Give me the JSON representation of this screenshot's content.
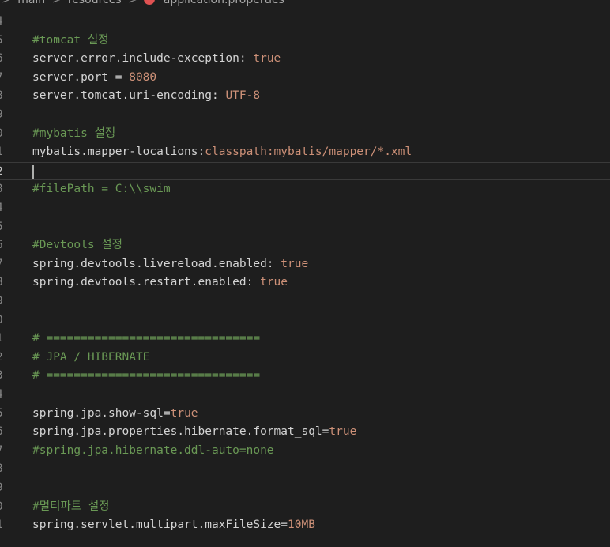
{
  "breadcrumb": {
    "items": [
      "main",
      "resources",
      "application.properties"
    ],
    "separator": ">"
  },
  "colors": {
    "key": "#d4d4d4",
    "value": "#ce9178",
    "comment": "#6a9955",
    "line_number": "#858585",
    "background": "#1e1e1e"
  },
  "editor": {
    "current_line_number": "2",
    "lines": [
      {
        "num": "4",
        "tokens": []
      },
      {
        "num": "5",
        "tokens": [
          {
            "type": "com",
            "text": "#tomcat 설정"
          }
        ]
      },
      {
        "num": "6",
        "tokens": [
          {
            "type": "key",
            "text": "server.error.include-exception: "
          },
          {
            "type": "val",
            "text": "true"
          }
        ]
      },
      {
        "num": "7",
        "tokens": [
          {
            "type": "key",
            "text": "server.port = "
          },
          {
            "type": "val",
            "text": "8080"
          }
        ]
      },
      {
        "num": "8",
        "tokens": [
          {
            "type": "key",
            "text": "server.tomcat.uri-encoding: "
          },
          {
            "type": "val",
            "text": "UTF-8"
          }
        ]
      },
      {
        "num": "9",
        "tokens": []
      },
      {
        "num": "0",
        "tokens": [
          {
            "type": "com",
            "text": "#mybatis 설정"
          }
        ]
      },
      {
        "num": "1",
        "tokens": [
          {
            "type": "key",
            "text": "mybatis.mapper-locations:"
          },
          {
            "type": "val",
            "text": "classpath:mybatis/mapper/*.xml"
          }
        ]
      },
      {
        "num": "2",
        "tokens": [],
        "current": true
      },
      {
        "num": "3",
        "tokens": [
          {
            "type": "com",
            "text": "#filePath = C:\\\\swim"
          }
        ]
      },
      {
        "num": "4",
        "tokens": []
      },
      {
        "num": "5",
        "tokens": []
      },
      {
        "num": "6",
        "tokens": [
          {
            "type": "com",
            "text": "#Devtools 설정"
          }
        ]
      },
      {
        "num": "7",
        "tokens": [
          {
            "type": "key",
            "text": "spring.devtools.livereload.enabled: "
          },
          {
            "type": "val",
            "text": "true"
          }
        ]
      },
      {
        "num": "8",
        "tokens": [
          {
            "type": "key",
            "text": "spring.devtools.restart.enabled: "
          },
          {
            "type": "val",
            "text": "true"
          }
        ]
      },
      {
        "num": "9",
        "tokens": []
      },
      {
        "num": "0",
        "tokens": []
      },
      {
        "num": "1",
        "tokens": [
          {
            "type": "com",
            "text": "# ==============================="
          }
        ]
      },
      {
        "num": "2",
        "tokens": [
          {
            "type": "com",
            "text": "# JPA / HIBERNATE"
          }
        ]
      },
      {
        "num": "3",
        "tokens": [
          {
            "type": "com",
            "text": "# ==============================="
          }
        ]
      },
      {
        "num": "4",
        "tokens": []
      },
      {
        "num": "5",
        "tokens": [
          {
            "type": "key",
            "text": "spring.jpa.show-sql="
          },
          {
            "type": "val",
            "text": "true"
          }
        ]
      },
      {
        "num": "6",
        "tokens": [
          {
            "type": "key",
            "text": "spring.jpa.properties.hibernate.format_sql="
          },
          {
            "type": "val",
            "text": "true"
          }
        ]
      },
      {
        "num": "7",
        "tokens": [
          {
            "type": "com",
            "text": "#spring.jpa.hibernate.ddl-auto=none"
          }
        ]
      },
      {
        "num": "8",
        "tokens": []
      },
      {
        "num": "9",
        "tokens": []
      },
      {
        "num": "0",
        "tokens": [
          {
            "type": "com",
            "text": "#멀티파트 설정"
          }
        ]
      },
      {
        "num": "1",
        "tokens": [
          {
            "type": "key",
            "text": "spring.servlet.multipart.maxFileSize="
          },
          {
            "type": "val",
            "text": "10MB"
          }
        ]
      }
    ]
  }
}
